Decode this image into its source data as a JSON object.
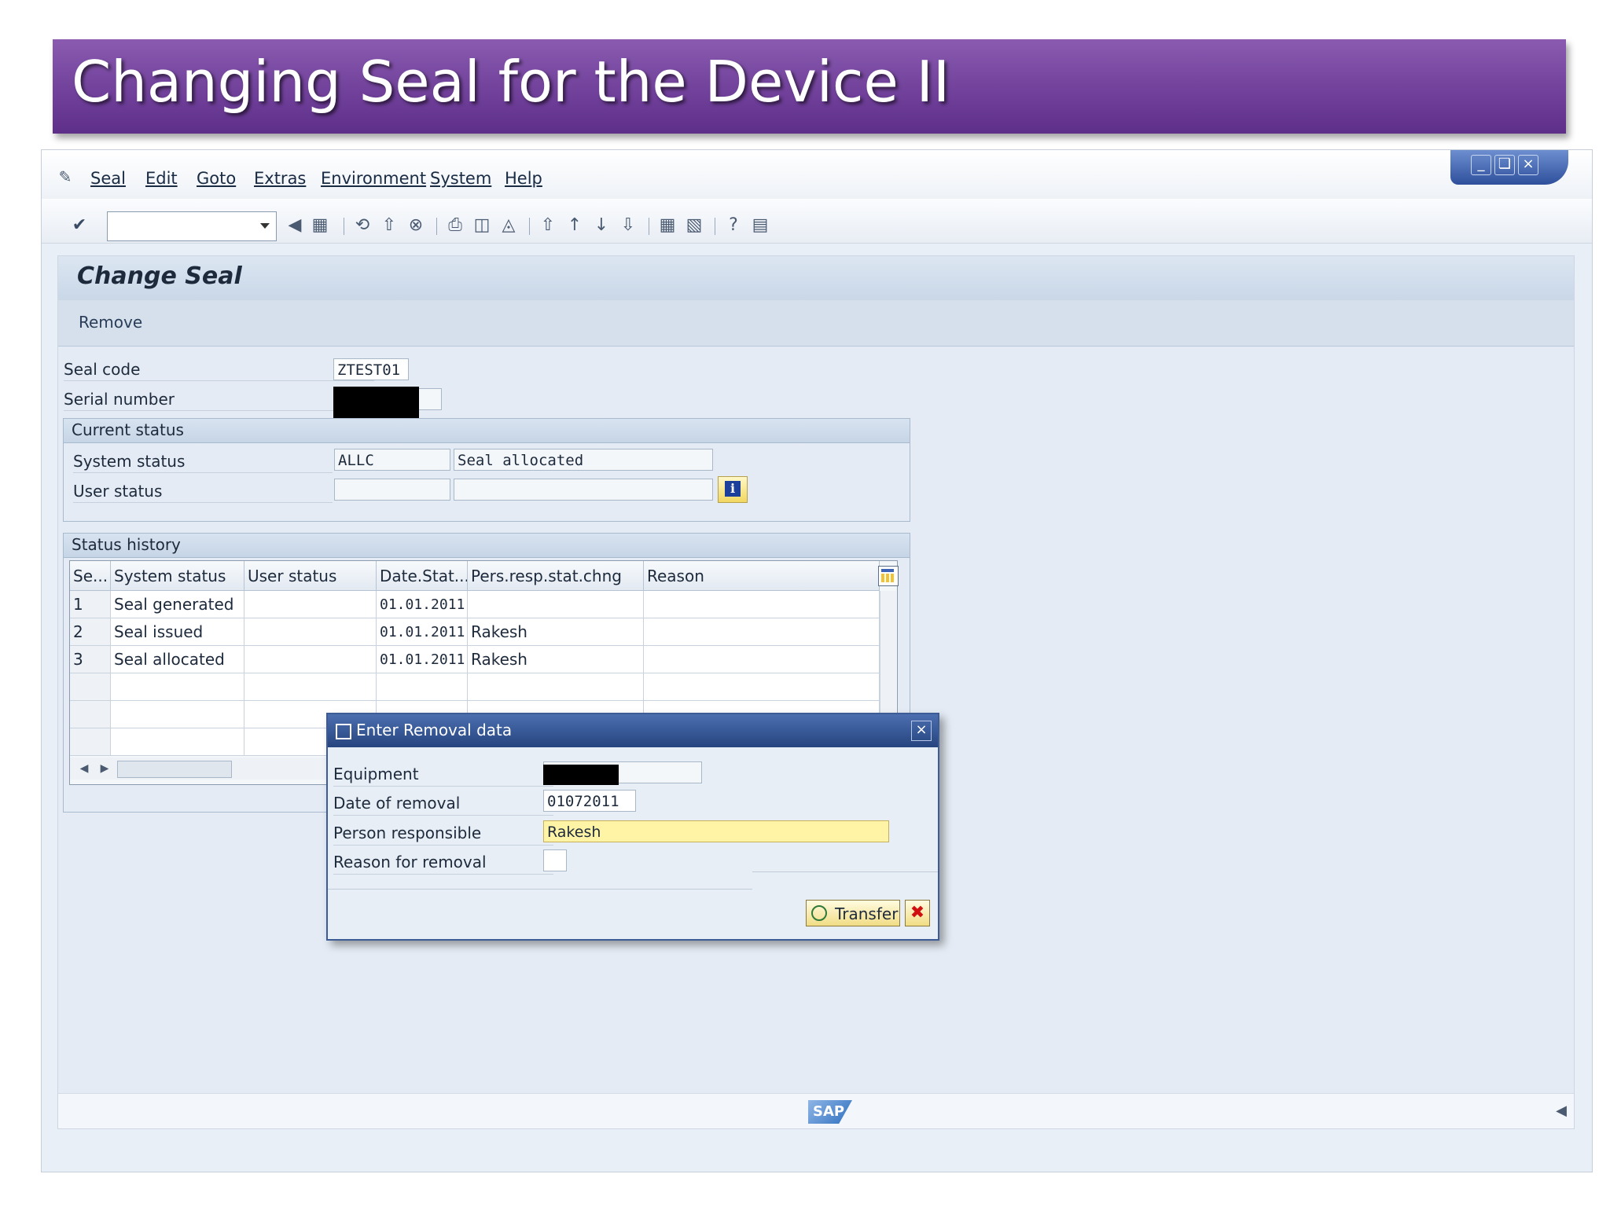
{
  "slide": {
    "title": "Changing Seal for the Device II"
  },
  "menu": {
    "items": [
      "Seal",
      "Edit",
      "Goto",
      "Extras",
      "Environment",
      "System",
      "Help"
    ]
  },
  "screen": {
    "title": "Change Seal",
    "app_toolbar": {
      "remove_label": "Remove"
    }
  },
  "header_fields": {
    "seal_code_label": "Seal code",
    "seal_code_value": "ZTEST01",
    "serial_number_label": "Serial number"
  },
  "current_status": {
    "title": "Current status",
    "system_status_label": "System status",
    "system_status_code": "ALLC",
    "system_status_text": "Seal allocated",
    "user_status_label": "User status"
  },
  "status_history": {
    "title": "Status history",
    "columns": [
      "Se...",
      "System status",
      "User status",
      "Date.Stat....",
      "Pers.resp.stat.chng",
      "Reason"
    ],
    "rows": [
      {
        "seq": "1",
        "system_status": "Seal generated",
        "user_status": "",
        "date": "01.01.2011",
        "person": "",
        "reason": ""
      },
      {
        "seq": "2",
        "system_status": "Seal issued",
        "user_status": "",
        "date": "01.01.2011",
        "person": "Rakesh",
        "reason": ""
      },
      {
        "seq": "3",
        "system_status": "Seal allocated",
        "user_status": "",
        "date": "01.01.2011",
        "person": "Rakesh",
        "reason": ""
      }
    ]
  },
  "dialog": {
    "title": "Enter Removal data",
    "equipment_label": "Equipment",
    "date_label": "Date of removal",
    "date_value": "01072011",
    "person_label": "Person responsible",
    "person_value": "Rakesh",
    "reason_label": "Reason for removal",
    "transfer_label": "Transfer"
  },
  "branding": {
    "logo_text": "SAP"
  },
  "colors": {
    "banner": "#7a4ca6",
    "dialog_title": "#26457f",
    "required_field": "#fff3a6"
  }
}
